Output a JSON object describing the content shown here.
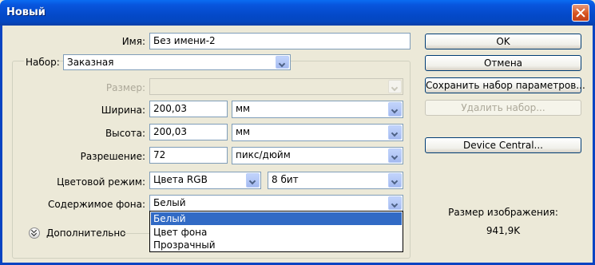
{
  "window": {
    "title": "Новый"
  },
  "fields": {
    "name": {
      "label": "Имя:",
      "value": "Без имени-2"
    },
    "preset": {
      "label": "Набор:",
      "value": "Заказная"
    },
    "size": {
      "label": "Размер:",
      "value": ""
    },
    "width": {
      "label": "Ширина:",
      "value": "200,03",
      "unit": "мм"
    },
    "height": {
      "label": "Высота:",
      "value": "200,03",
      "unit": "мм"
    },
    "resolution": {
      "label": "Разрешение:",
      "value": "72",
      "unit": "пикс/дюйм"
    },
    "color_mode": {
      "label": "Цветовой режим:",
      "value": "Цвета RGB",
      "depth": "8 бит"
    },
    "background": {
      "label": "Содержимое фона:",
      "value": "Белый",
      "options": [
        "Белый",
        "Цвет фона",
        "Прозрачный"
      ],
      "selected_index": 0
    }
  },
  "advanced": {
    "label": "Дополнительно"
  },
  "buttons": {
    "ok": "OK",
    "cancel": "Отмена",
    "save_preset": "Сохранить набор параметров...",
    "delete_preset": "Удалить набор...",
    "device_central": "Device Central..."
  },
  "image_size": {
    "label": "Размер изображения:",
    "value": "941,9K"
  }
}
